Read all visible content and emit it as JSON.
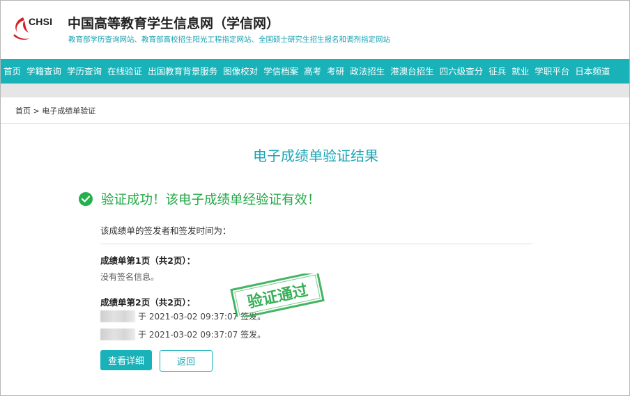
{
  "header": {
    "logo_text": "CHSI",
    "title": "中国高等教育学生信息网（学信网）",
    "subtitle": "教育部学历查询网站、教育部高校招生阳光工程指定网站、全国硕士研究生招生报名和调剂指定网站"
  },
  "nav": {
    "items": [
      "首页",
      "学籍查询",
      "学历查询",
      "在线验证",
      "出国教育背景服务",
      "图像校对",
      "学信档案",
      "高考",
      "考研",
      "政法招生",
      "港澳台招生",
      "四六级查分",
      "征兵",
      "就业",
      "学职平台",
      "日本频道"
    ]
  },
  "breadcrumb": {
    "home": "首页",
    "separator": ">",
    "current": "电子成绩单验证"
  },
  "result": {
    "title": "电子成绩单验证结果",
    "success": "验证成功！该电子成绩单经验证有效！",
    "intro": "该成绩单的签发者和签发时间为：",
    "page1_label": "成绩单第1页（共2页）：",
    "page1_note": "没有签名信息。",
    "page2_label": "成绩单第2页（共2页）：",
    "signer1_text": "于 2021-03-02 09:37:07 签发。",
    "signer2_text": "于 2021-03-02 09:37:07 签发。"
  },
  "stamp": {
    "text": "验证通过",
    "color": "#22a845"
  },
  "buttons": {
    "details": "查看详细",
    "back": "返回"
  },
  "colors": {
    "accent": "#1ab2b9",
    "success": "#22b14c"
  }
}
